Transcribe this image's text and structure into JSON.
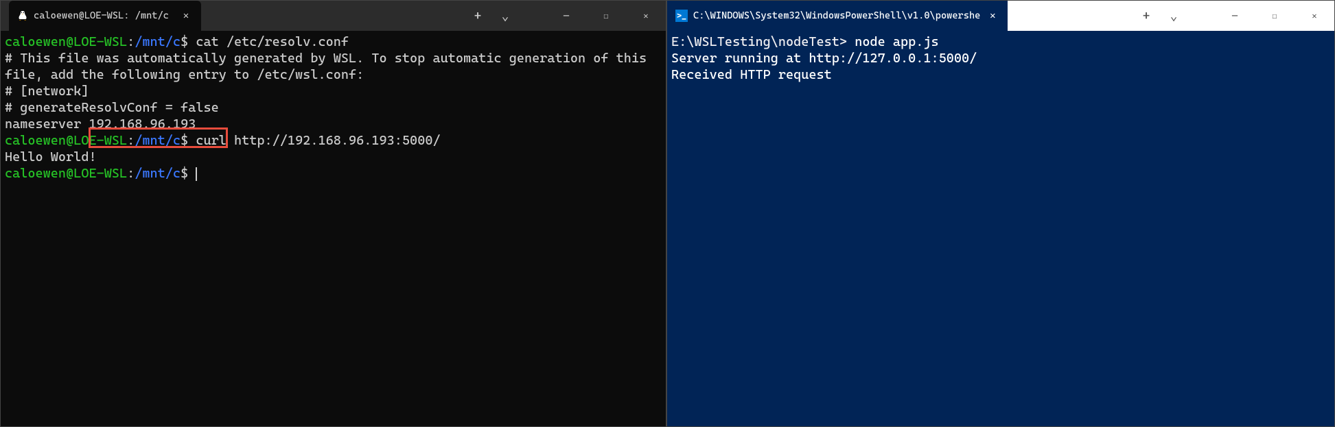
{
  "leftWindow": {
    "tab": {
      "title": "caloewen@LOE-WSL: /mnt/c",
      "iconName": "tux-icon"
    },
    "terminal": {
      "line1": {
        "prompt_user": "caloewen@LOE-WSL",
        "colon": ":",
        "prompt_path": "/mnt/c",
        "dollar": "$",
        "command": " cat /etc/resolv.conf"
      },
      "output1": "# This file was automatically generated by WSL. To stop automatic generation of this file, add the following entry to /etc/wsl.conf:",
      "output2": "# [network]",
      "output3": "# generateResolvConf = false",
      "output4_prefix": "nameserver ",
      "output4_ip": "192.168.96.193",
      "line2": {
        "prompt_user": "caloewen@LOE-WSL",
        "colon": ":",
        "prompt_path": "/mnt/c",
        "dollar": "$",
        "command": " curl http://192.168.96.193:5000/"
      },
      "output5": "Hello World!",
      "line3": {
        "prompt_user": "caloewen@LOE-WSL",
        "colon": ":",
        "prompt_path": "/mnt/c",
        "dollar": "$"
      }
    },
    "highlight": {
      "value": "192.168.96.193"
    }
  },
  "rightWindow": {
    "tab": {
      "title": "C:\\WINDOWS\\System32\\WindowsPowerShell\\v1.0\\powershe",
      "iconName": "powershell-icon",
      "iconText": ">_"
    },
    "terminal": {
      "line1": {
        "prompt_path": "E:\\WSLTesting\\nodeTest>",
        "command": " node app.js"
      },
      "output1": "Server running at http://127.0.0.1:5000/",
      "output2": "Received HTTP request"
    }
  },
  "controls": {
    "plus": "+",
    "chevron": "⌄",
    "minimize": "─",
    "maximize": "☐",
    "close": "✕",
    "tabClose": "✕"
  }
}
